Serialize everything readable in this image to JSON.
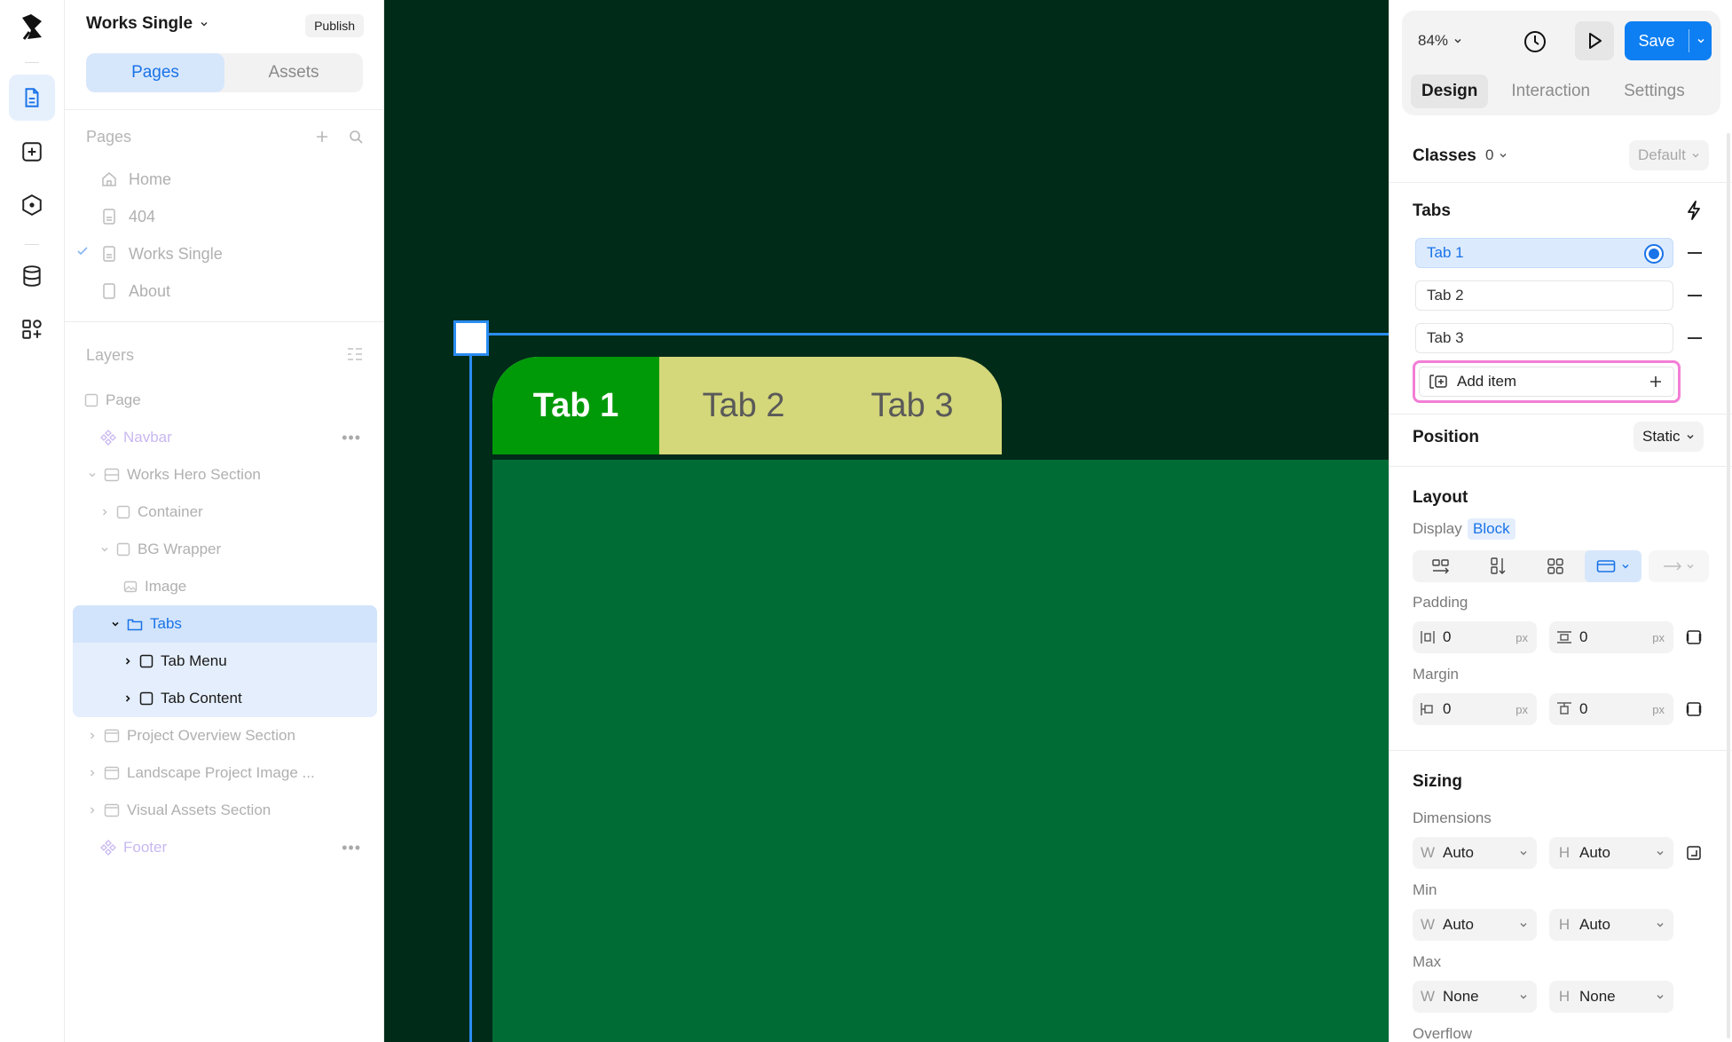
{
  "app": {
    "project_name": "Works Single",
    "publish_label": "Publish"
  },
  "left_tabs": [
    "Pages",
    "Assets"
  ],
  "pages_section": {
    "title": "Pages",
    "items": [
      {
        "label": "Home",
        "icon": "home-icon"
      },
      {
        "label": "404",
        "icon": "page-icon"
      },
      {
        "label": "Works Single",
        "icon": "page-icon",
        "current": true
      },
      {
        "label": "About",
        "icon": "page-icon"
      }
    ]
  },
  "layers_section": {
    "title": "Layers",
    "items": [
      {
        "label": "Page"
      },
      {
        "label": "Navbar"
      },
      {
        "label": "Works Hero Section"
      },
      {
        "label": "Container"
      },
      {
        "label": "BG Wrapper"
      },
      {
        "label": "Image"
      },
      {
        "label": "Tabs"
      },
      {
        "label": "Tab Menu"
      },
      {
        "label": "Tab Content"
      },
      {
        "label": "Project Overview Section"
      },
      {
        "label": "Landscape Project Image ..."
      },
      {
        "label": "Visual Assets Section"
      },
      {
        "label": "Footer"
      }
    ]
  },
  "canvas": {
    "tabs": [
      "Tab 1",
      "Tab 2",
      "Tab 3"
    ],
    "colors": {
      "background": "#002b19",
      "active_tab": "#009a09",
      "tab_bar": "#d4d77a",
      "content": "#006c35",
      "selection": "#2a8cf0"
    }
  },
  "toolbar": {
    "zoom": "84%",
    "save_label": "Save"
  },
  "right_tabs": [
    "Design",
    "Interaction",
    "Settings"
  ],
  "classes": {
    "label": "Classes",
    "count": "0",
    "state": "Default"
  },
  "tabs_panel": {
    "title": "Tabs",
    "items": [
      "Tab 1",
      "Tab 2",
      "Tab 3"
    ],
    "add_label": "Add item"
  },
  "position": {
    "label": "Position",
    "value": "Static"
  },
  "layout": {
    "title": "Layout",
    "display_label": "Display",
    "display_value": "Block",
    "padding_label": "Padding",
    "padding": [
      "0",
      "0"
    ],
    "margin_label": "Margin",
    "margin": [
      "0",
      "0"
    ],
    "unit": "px"
  },
  "sizing": {
    "title": "Sizing",
    "dimensions_label": "Dimensions",
    "dimensions": [
      "Auto",
      "Auto"
    ],
    "min_label": "Min",
    "min": [
      "Auto",
      "Auto"
    ],
    "max_label": "Max",
    "max": [
      "None",
      "None"
    ],
    "overflow_label": "Overflow",
    "w_prefix": "W",
    "h_prefix": "H"
  }
}
